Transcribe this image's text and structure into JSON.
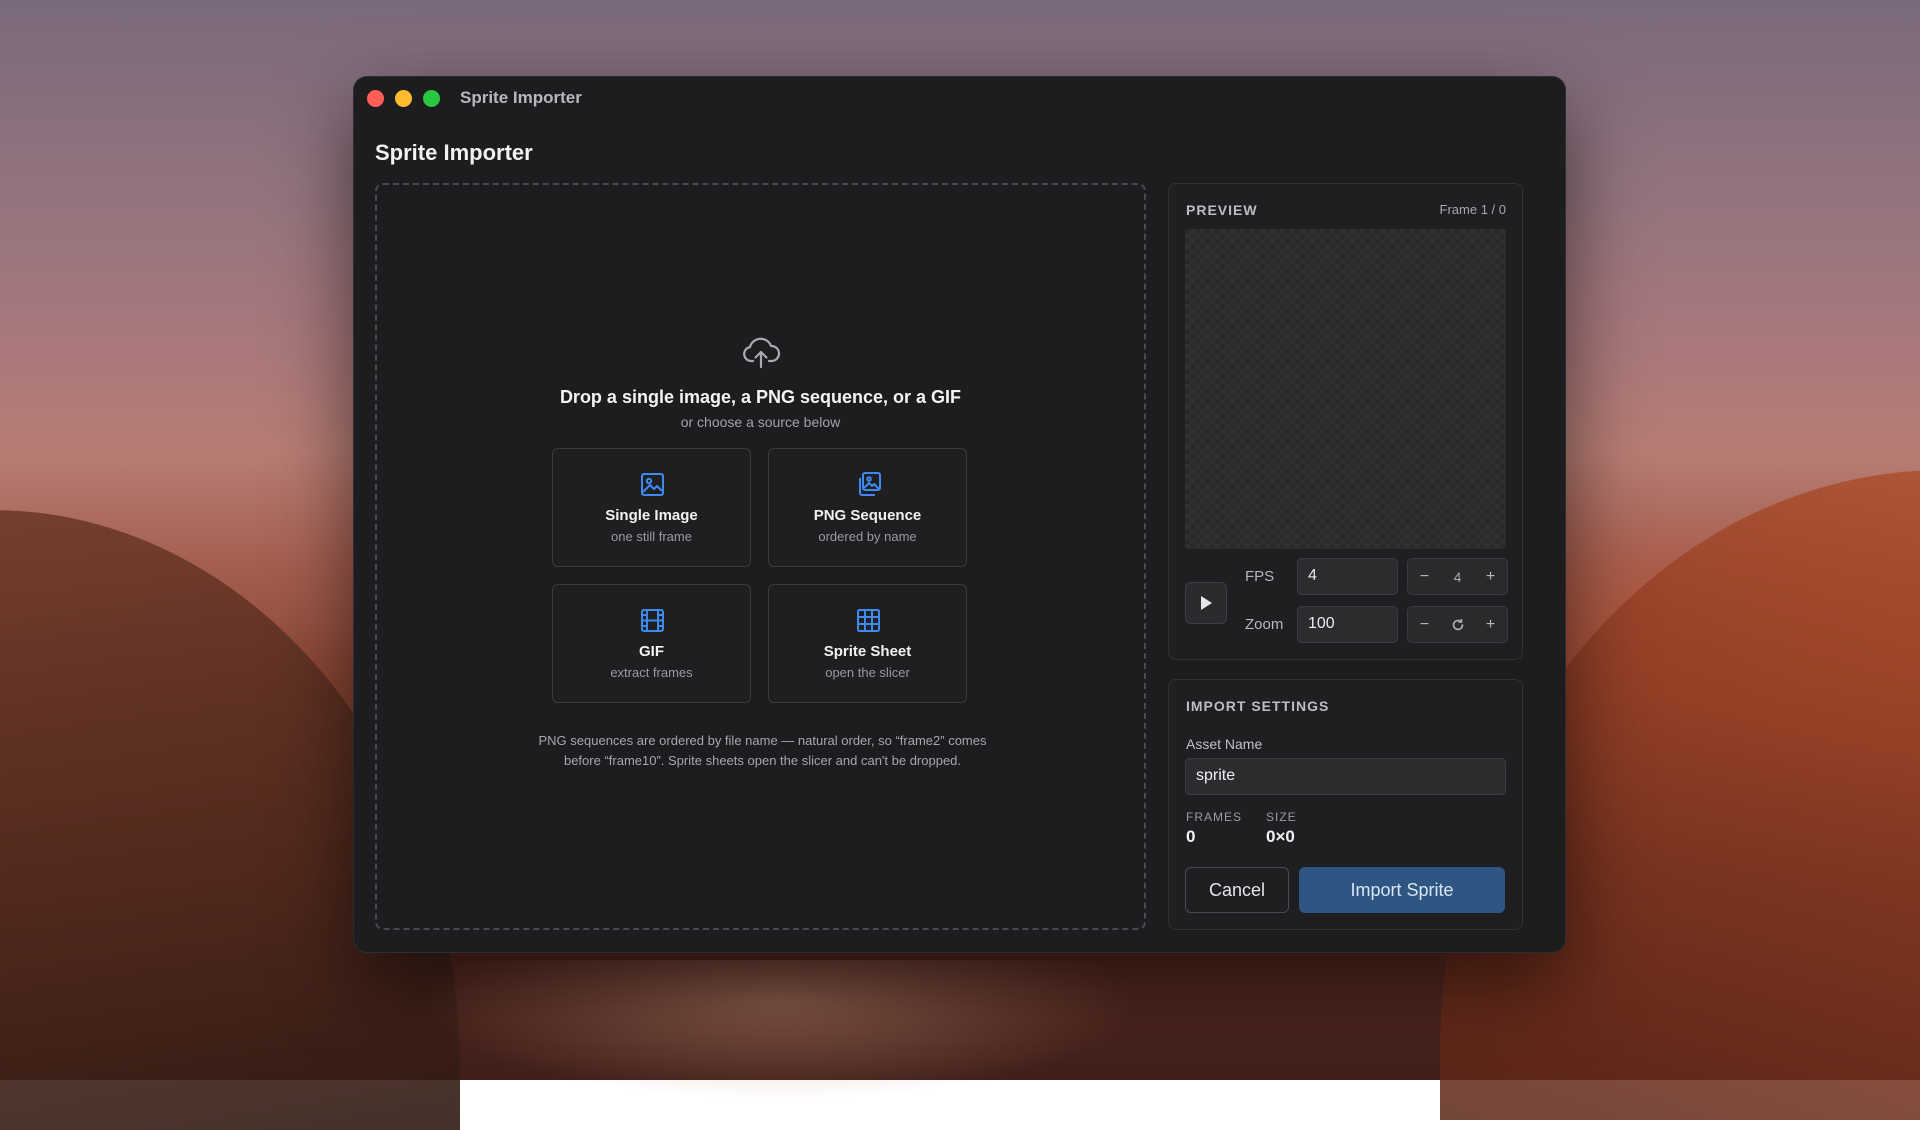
{
  "window": {
    "title": "Sprite Importer",
    "heading": "Sprite Importer"
  },
  "dropzone": {
    "heading": "Drop a single image, a PNG sequence, or a GIF",
    "subheading": "or choose a source below",
    "icon": "cloud-upload-icon",
    "sources": [
      {
        "name": "Single Image",
        "desc": "one still frame",
        "icon": "image-icon"
      },
      {
        "name": "PNG Sequence",
        "desc": "ordered by name",
        "icon": "images-stack-icon"
      },
      {
        "name": "GIF",
        "desc": "extract frames",
        "icon": "film-icon"
      },
      {
        "name": "Sprite Sheet",
        "desc": "open the slicer",
        "icon": "grid-icon"
      }
    ],
    "note": "PNG sequences are ordered by file name — natural order, so “frame2” comes before “frame10”. Sprite sheets open the slicer and can't be dropped."
  },
  "preview": {
    "heading": "PREVIEW",
    "frame_counter": "Frame 1 / 0",
    "fps_label": "FPS",
    "fps_value": "4",
    "fps_stepper_value": "4",
    "zoom_label": "Zoom",
    "zoom_value": "100"
  },
  "import_settings": {
    "heading": "IMPORT SETTINGS",
    "asset_name_label": "Asset Name",
    "asset_name_value": "sprite",
    "frames_label": "FRAMES",
    "frames_value": "0",
    "size_label": "SIZE",
    "size_value": "0×0",
    "cancel_label": "Cancel",
    "import_label": "Import Sprite"
  },
  "colors": {
    "accent": "#2f5682",
    "icon_blue": "#3d8bf2",
    "close": "#ff5f57",
    "minimize": "#febc2e",
    "maximize": "#28c840"
  }
}
